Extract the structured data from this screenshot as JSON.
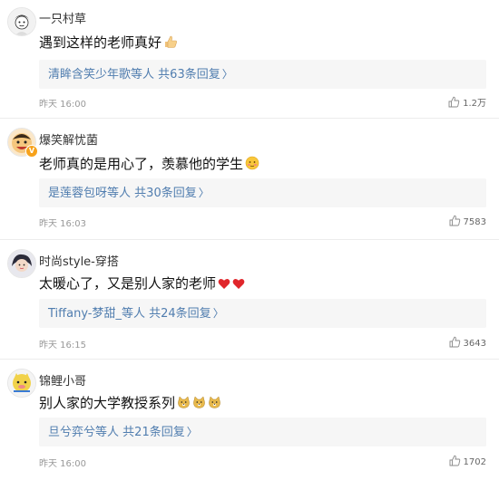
{
  "comments": [
    {
      "username": "一只村草",
      "text": "遇到这样的老师真好",
      "emoji": [
        "thumbs-up"
      ],
      "reply_names": "清眸含笑少年歌",
      "reply_mid": "等人",
      "reply_count": "共63条回复",
      "time": "昨天 16:00",
      "likes": "1.2万",
      "verified": false
    },
    {
      "username": "爆笑解忧菌",
      "text": "老师真的是用心了，羡慕他的学生",
      "emoji": [
        "blush-face"
      ],
      "reply_names": "是莲蓉包呀",
      "reply_mid": "等人",
      "reply_count": "共30条回复",
      "time": "昨天 16:03",
      "likes": "7583",
      "verified": true
    },
    {
      "username": "时尚style-穿搭",
      "text": "太暖心了，又是别人家的老师",
      "emoji": [
        "red-heart",
        "red-heart"
      ],
      "reply_names": "Tiffany-梦甜_",
      "reply_mid": "等人",
      "reply_count": "共24条回复",
      "time": "昨天 16:15",
      "likes": "3643",
      "verified": false
    },
    {
      "username": "锦鲤小哥",
      "text": "别人家的大学教授系列",
      "emoji": [
        "doge-face",
        "doge-face",
        "doge-face"
      ],
      "reply_names": "旦兮弈兮",
      "reply_mid": "等人",
      "reply_count": "共21条回复",
      "time": "昨天 16:00",
      "likes": "1702",
      "verified": false
    }
  ],
  "colors": {
    "link": "#507daf",
    "reply_bg": "#f6f6f6",
    "meta": "#999999",
    "separator": "#ececec"
  }
}
